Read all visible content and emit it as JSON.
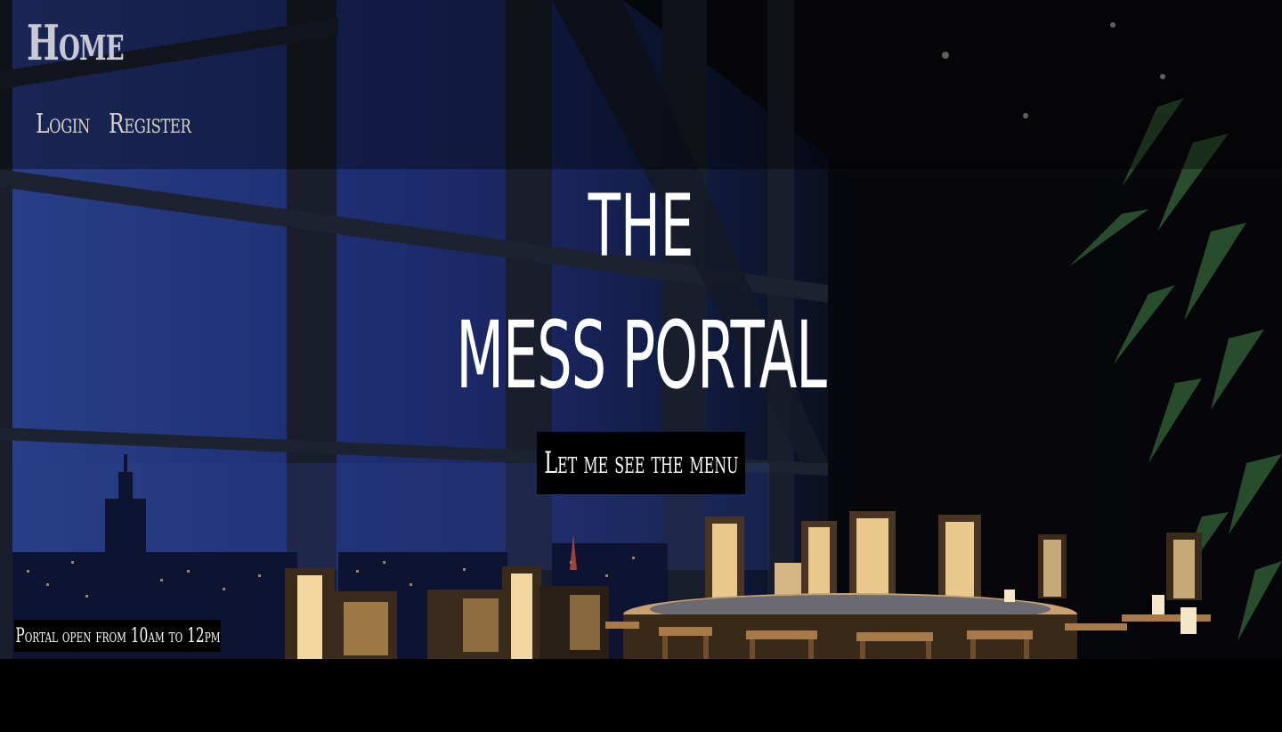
{
  "header": {
    "brand": "Home",
    "nav": [
      {
        "label": "Login"
      },
      {
        "label": "Register"
      }
    ]
  },
  "hero": {
    "title_line1": "the",
    "title_line2": "mess portal",
    "menu_button_label": "Let me see the menu",
    "hours_text": "Portal open from 10am to 12pm"
  },
  "colors": {
    "background": "#000000",
    "text": "#ffffff",
    "nav_text": "#d9d3c6",
    "brand_text": "#c9c9d6",
    "window_blue": "#2a3f8a"
  }
}
